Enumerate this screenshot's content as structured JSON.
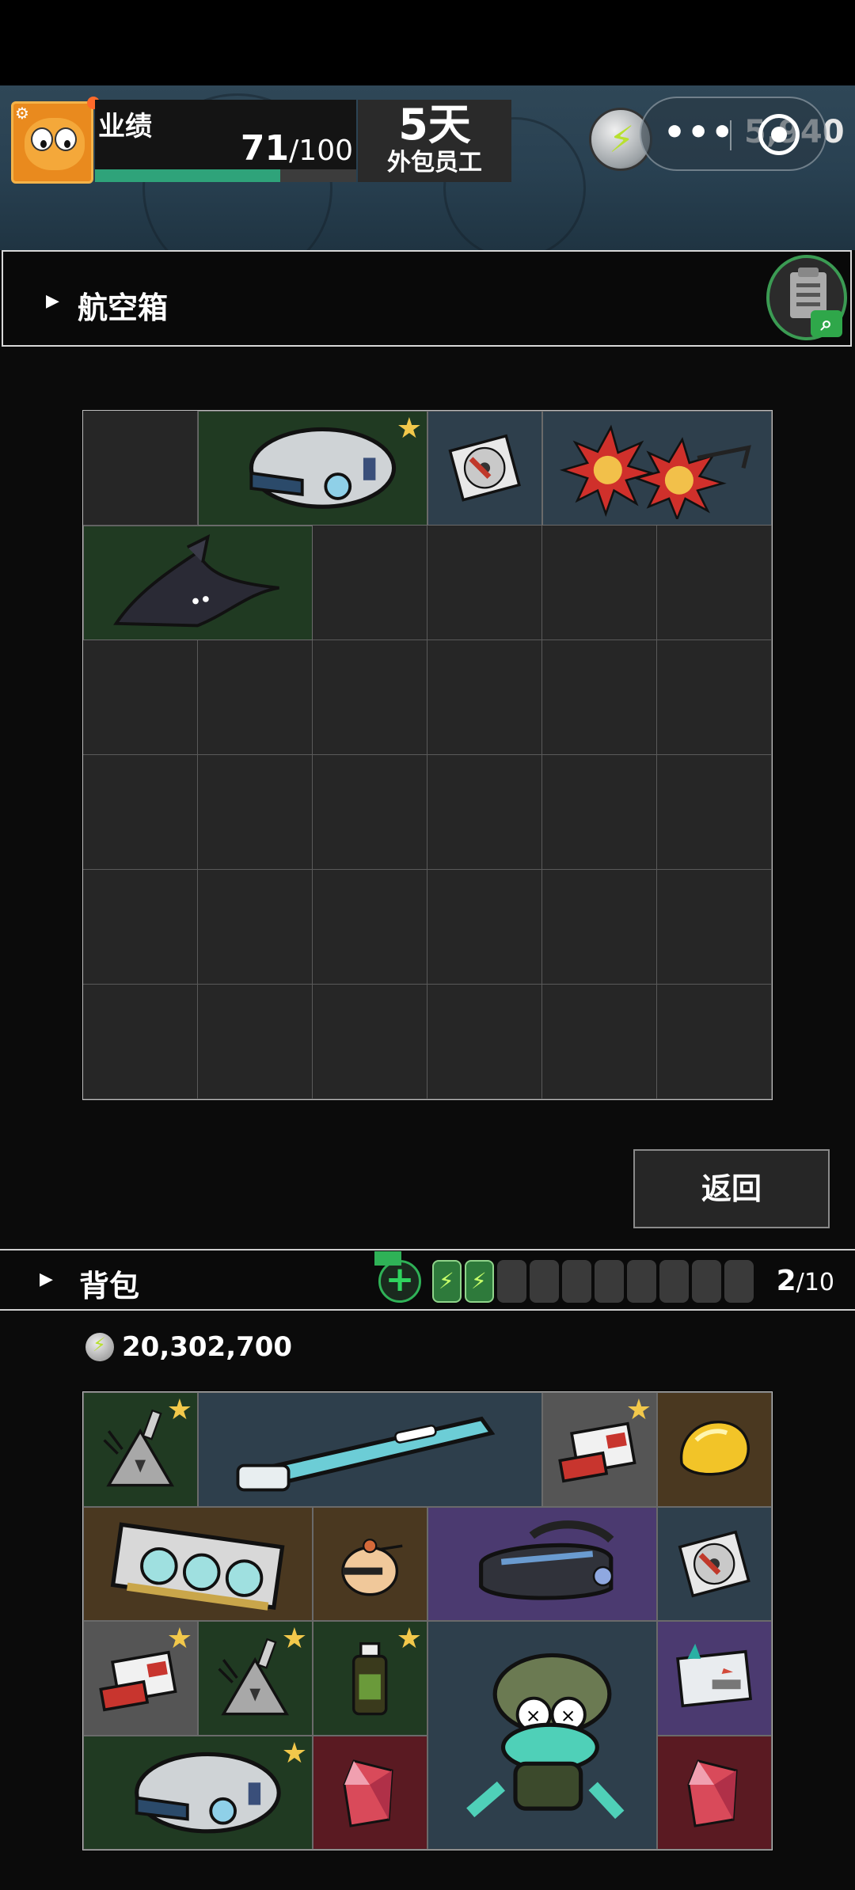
{
  "hud": {
    "performance_label": "业绩",
    "performance_value": "71",
    "performance_max": "/100",
    "performance_fraction": 0.71,
    "days": "5天",
    "role": "外包员工",
    "coin_readout": "5,940",
    "accent_green": "#2fa37a"
  },
  "flight_case": {
    "title": "航空箱",
    "inspect_icon": "clipboard-search-icon",
    "columns": 6,
    "rows": 6,
    "items": [
      {
        "name": "helmet",
        "icon": "helmet-icon",
        "rarity": "green",
        "starred": true,
        "col": 2,
        "row": 1,
        "w": 2,
        "h": 1
      },
      {
        "name": "cd-disc",
        "icon": "disc-icon",
        "rarity": "slate",
        "starred": false,
        "col": 4,
        "row": 1,
        "w": 1,
        "h": 1
      },
      {
        "name": "sun-glasses",
        "icon": "sun-glasses-icon",
        "rarity": "slate",
        "starred": false,
        "col": 5,
        "row": 1,
        "w": 2,
        "h": 1
      },
      {
        "name": "shadow-creature",
        "icon": "shadow-creature-icon",
        "rarity": "green",
        "starred": false,
        "col": 1,
        "row": 2,
        "w": 2,
        "h": 1
      }
    ]
  },
  "return_button": "返回",
  "backpack": {
    "title": "背包",
    "capacity_used": "2",
    "capacity_max": "/10",
    "slots_filled": 2,
    "slots_total": 10,
    "money": "20,302,700",
    "columns": 6,
    "rows": 4,
    "items": [
      {
        "name": "triangle-device",
        "icon": "triangle-device-icon",
        "rarity": "green",
        "starred": true,
        "col": 1,
        "row": 1,
        "w": 1,
        "h": 1
      },
      {
        "name": "electric-toothbrush",
        "icon": "toothbrush-icon",
        "rarity": "slate",
        "starred": false,
        "col": 2,
        "row": 1,
        "w": 3,
        "h": 1
      },
      {
        "name": "cigarette-pack",
        "icon": "cigarette-pack-icon",
        "rarity": "gray",
        "starred": true,
        "col": 5,
        "row": 1,
        "w": 1,
        "h": 1
      },
      {
        "name": "gold-nugget",
        "icon": "gold-nugget-icon",
        "rarity": "brown",
        "starred": false,
        "col": 6,
        "row": 1,
        "w": 1,
        "h": 1
      },
      {
        "name": "graphics-card",
        "icon": "graphics-card-icon",
        "rarity": "brown",
        "starred": false,
        "col": 1,
        "row": 2,
        "w": 2,
        "h": 1
      },
      {
        "name": "egg-timer",
        "icon": "egg-timer-icon",
        "rarity": "brown",
        "starred": false,
        "col": 3,
        "row": 2,
        "w": 1,
        "h": 1
      },
      {
        "name": "vr-headset",
        "icon": "vr-headset-icon",
        "rarity": "purple",
        "starred": false,
        "col": 4,
        "row": 2,
        "w": 2,
        "h": 1
      },
      {
        "name": "cd-disc",
        "icon": "disc-icon",
        "rarity": "slate",
        "starred": false,
        "col": 6,
        "row": 2,
        "w": 1,
        "h": 1
      },
      {
        "name": "cigarette-pack",
        "icon": "cigarette-pack-icon",
        "rarity": "gray",
        "starred": true,
        "col": 1,
        "row": 3,
        "w": 1,
        "h": 1
      },
      {
        "name": "triangle-device",
        "icon": "triangle-device-icon",
        "rarity": "green",
        "starred": true,
        "col": 2,
        "row": 3,
        "w": 1,
        "h": 1
      },
      {
        "name": "medicine-bottle",
        "icon": "medicine-bottle-icon",
        "rarity": "green",
        "starred": true,
        "col": 3,
        "row": 3,
        "w": 1,
        "h": 1
      },
      {
        "name": "frog-doll",
        "icon": "frog-doll-icon",
        "rarity": "slate",
        "starred": false,
        "col": 4,
        "row": 3,
        "w": 2,
        "h": 2
      },
      {
        "name": "postcard",
        "icon": "postcard-icon",
        "rarity": "purple",
        "starred": false,
        "col": 6,
        "row": 3,
        "w": 1,
        "h": 1
      },
      {
        "name": "helmet",
        "icon": "helmet-icon",
        "rarity": "green",
        "starred": true,
        "col": 1,
        "row": 4,
        "w": 2,
        "h": 1
      },
      {
        "name": "red-crystal",
        "icon": "red-crystal-icon",
        "rarity": "red",
        "starred": false,
        "col": 3,
        "row": 4,
        "w": 1,
        "h": 1
      },
      {
        "name": "red-crystal",
        "icon": "red-crystal-icon",
        "rarity": "red",
        "starred": false,
        "col": 6,
        "row": 4,
        "w": 1,
        "h": 1
      }
    ]
  }
}
